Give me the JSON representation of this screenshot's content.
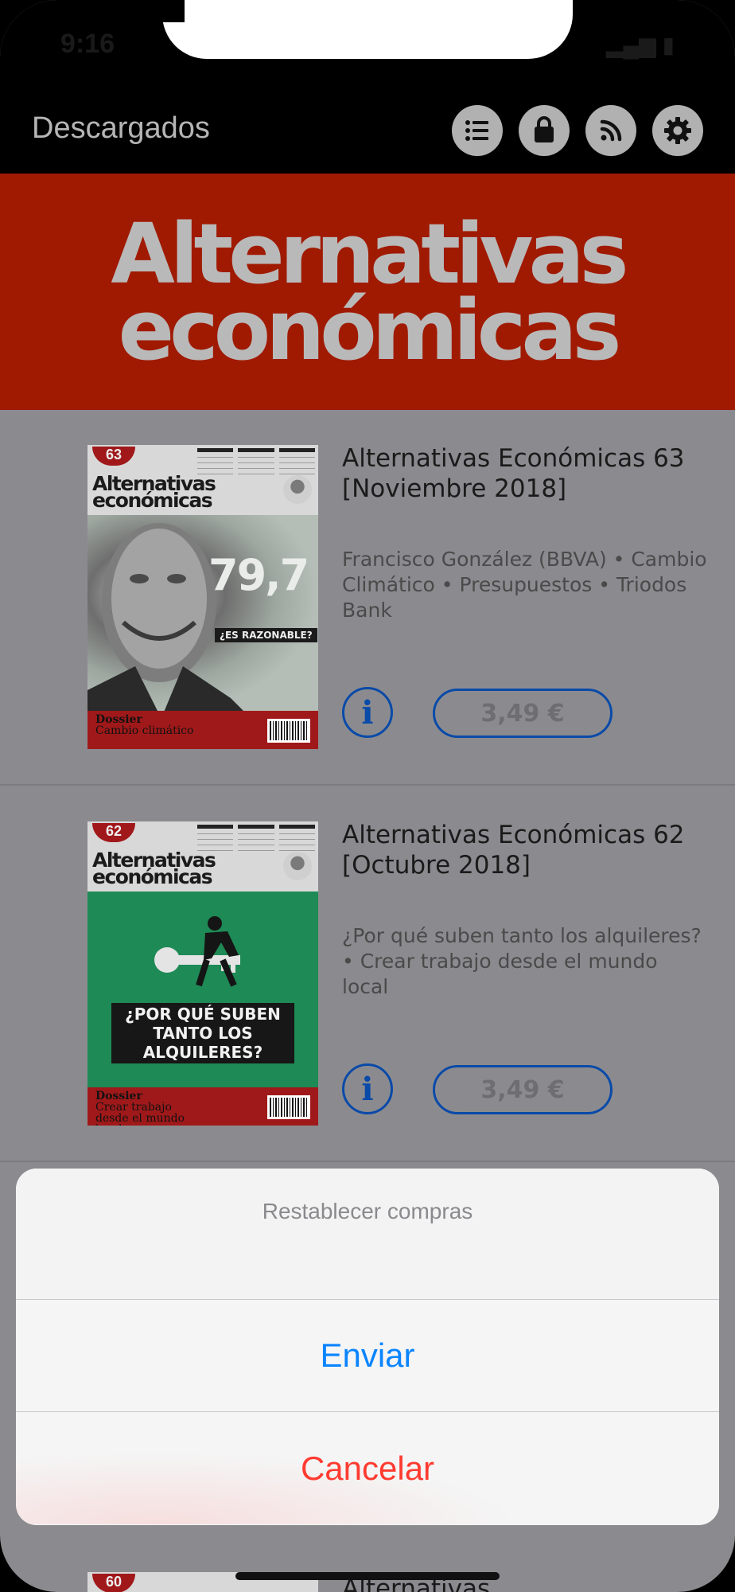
{
  "status": {
    "time": "9:16",
    "indicators": "▂▄▆ ▮"
  },
  "nav": {
    "title": "Descargados",
    "icons": [
      "list-icon",
      "bag-icon",
      "rss-icon",
      "gear-icon"
    ]
  },
  "banner": {
    "line1": "Alternativas",
    "line2": "económicas"
  },
  "items": [
    {
      "title": "Alternativas Económicas 63 [Noviembre 2018]",
      "desc": "Francisco González (BBVA) • Cambio Climático • Presupuestos • Triodos Bank",
      "info": "i",
      "price": "3,49 €",
      "cover": {
        "badge": "63",
        "mast1": "Alternativas",
        "mast2": "económicas",
        "big": "79,7",
        "tag": "¿ES RAZONABLE?",
        "dossier": "Dossier",
        "dossier_sub": "Cambio climático"
      }
    },
    {
      "title": "Alternativas Económicas 62 [Octubre 2018]",
      "desc": "¿Por qué suben tanto los alquileres? • Crear trabajo desde el mundo local",
      "info": "i",
      "price": "3,49 €",
      "cover": {
        "badge": "62",
        "mast1": "Alternativas",
        "mast2": "económicas",
        "headline": "¿POR QUÉ SUBEN TANTO LOS ALQUILERES?",
        "dossier": "Dossier",
        "dossier_sub": "Crear trabajo desde el mundo local"
      }
    }
  ],
  "sheet": {
    "title": "Restablecer compras",
    "send": "Enviar",
    "cancel": "Cancelar"
  },
  "peek": {
    "title": "Alternativas",
    "badge": "60"
  },
  "colors": {
    "brand_red": "#a01a02",
    "link_blue": "#0a84ff",
    "destructive": "#ff3b30",
    "button_blue": "#0a4aa8"
  }
}
